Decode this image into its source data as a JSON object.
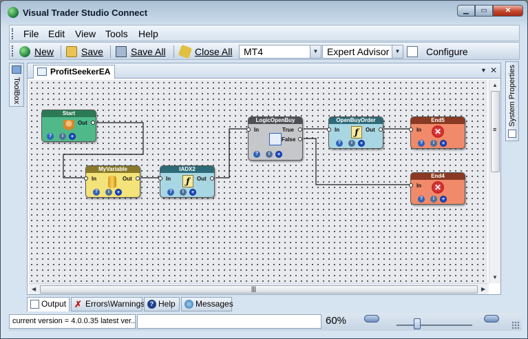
{
  "window": {
    "title": "Visual Trader Studio Connect",
    "min_glyph": "▁",
    "max_glyph": "▭",
    "close_glyph": "✕"
  },
  "menu": [
    {
      "label": "File"
    },
    {
      "label": "Edit"
    },
    {
      "label": "View"
    },
    {
      "label": "Tools"
    },
    {
      "label": "Help"
    }
  ],
  "toolbar": {
    "new_label": "New",
    "save_label": "Save",
    "save_all_label": "Save All",
    "close_all_label": "Close All",
    "platform_value": "MT4",
    "type_value": "Expert Advisor",
    "configure_label": "Configure",
    "combo_arrow": "▼"
  },
  "side_tabs": {
    "toolbox": "ToolBox",
    "system_properties": "System Properties"
  },
  "document": {
    "tab_label": "ProfitSeekerEA",
    "dropdown_glyph": "▼",
    "close_glyph": "✕"
  },
  "nodes": [
    {
      "id": "start",
      "title": "Start",
      "outputs": [
        "Out"
      ],
      "inputs": [],
      "header_color": "#2c7a55",
      "body_color": "#4fb98a"
    },
    {
      "id": "myvariable",
      "title": "MyVariable",
      "inputs": [
        "In"
      ],
      "outputs": [
        "Out"
      ],
      "header_color": "#8a7a2a",
      "body_color": "#f4e27a"
    },
    {
      "id": "iadx2",
      "title": "IADX2",
      "inputs": [
        "In"
      ],
      "outputs": [
        "Out"
      ],
      "header_color": "#2d6b78",
      "body_color": "#a9d6e3"
    },
    {
      "id": "logicopenbuy",
      "title": "LogicOpenBuy",
      "inputs": [
        "In"
      ],
      "outputs": [
        "True",
        "False"
      ],
      "header_color": "#4d5056",
      "body_color": "#c6c7ca"
    },
    {
      "id": "openbuyorder",
      "title": "OpenBuyOrder",
      "inputs": [
        "In"
      ],
      "outputs": [
        "Out"
      ],
      "header_color": "#2d6b78",
      "body_color": "#a9d6e3"
    },
    {
      "id": "end5",
      "title": "End5",
      "inputs": [
        "In"
      ],
      "outputs": [],
      "header_color": "#8a3a22",
      "body_color": "#f08a6a"
    },
    {
      "id": "end4",
      "title": "End4",
      "inputs": [
        "In"
      ],
      "outputs": [],
      "header_color": "#8a3a22",
      "body_color": "#f08a6a"
    }
  ],
  "node_buttons": {
    "help": "?",
    "info": "i",
    "add": "+"
  },
  "scroll": {
    "up": "▲",
    "down": "▼",
    "left": "◀",
    "right": "▶",
    "grip_h": "|||",
    "grip_v": "≡"
  },
  "bottom_tabs": [
    {
      "label": "Output",
      "active": true
    },
    {
      "label": "Errors\\Warnings",
      "active": false
    },
    {
      "label": "Help",
      "active": false
    },
    {
      "label": "Messages",
      "active": false
    }
  ],
  "status": {
    "version_text": "current version = 4.0.0.35 latest ver...",
    "zoom": "60%"
  }
}
